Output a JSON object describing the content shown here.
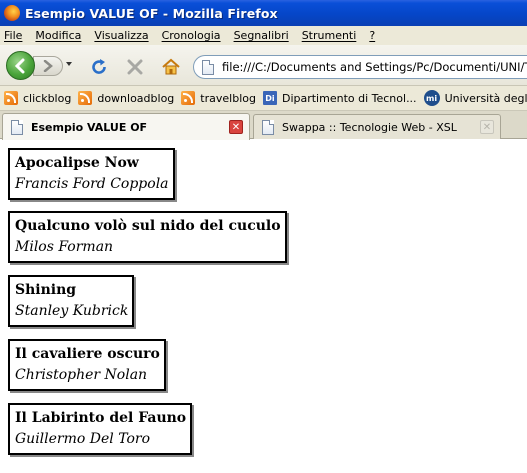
{
  "window": {
    "title": "Esempio VALUE OF - Mozilla Firefox"
  },
  "menu": [
    "File",
    "Modifica",
    "Visualizza",
    "Cronologia",
    "Segnalibri",
    "Strumenti",
    "?"
  ],
  "address": {
    "url": "file:///C:/Documents and Settings/Pc/Documenti/UNI/Tec_Web"
  },
  "bookmarks": [
    {
      "label": "clickblog",
      "icon": "rss-icon"
    },
    {
      "label": "downloadblog",
      "icon": "rss-icon"
    },
    {
      "label": "travelblog",
      "icon": "rss-icon"
    },
    {
      "label": "Dipartimento di Tecnol...",
      "icon": "dipartimento-icon"
    },
    {
      "label": "Università degli Studi ...",
      "icon": "university-icon"
    }
  ],
  "tabs": [
    {
      "label": "Esempio VALUE OF",
      "active": true
    },
    {
      "label": "Swappa :: Tecnologie Web - XSL",
      "active": false
    }
  ],
  "films": [
    {
      "title": "Apocalipse Now",
      "director": "Francis Ford Coppola"
    },
    {
      "title": "Qualcuno volò sul nido del cuculo",
      "director": "Milos Forman"
    },
    {
      "title": "Shining",
      "director": "Stanley Kubrick"
    },
    {
      "title": "Il cavaliere oscuro",
      "director": "Christopher Nolan"
    },
    {
      "title": "Il Labirinto del Fauno",
      "director": "Guillermo Del Toro"
    }
  ]
}
